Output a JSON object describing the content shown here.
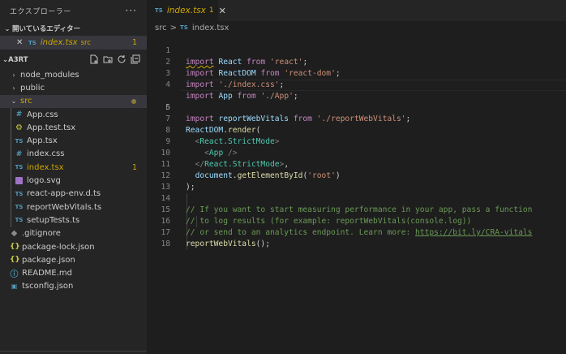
{
  "explorer": {
    "title": "エクスプローラー",
    "more": "···",
    "open_editors": {
      "header": "開いているエディター",
      "items": [
        {
          "close": "✕",
          "badge": "TS",
          "name": "index.tsx",
          "path": "src",
          "count": "1"
        }
      ]
    },
    "project": {
      "header": "A3RT",
      "tree": [
        {
          "name": "node_modules",
          "type": "folder",
          "expanded": false
        },
        {
          "name": "public",
          "type": "folder",
          "expanded": false
        },
        {
          "name": "src",
          "type": "folder",
          "expanded": true
        },
        {
          "name": "App.css",
          "type": "css"
        },
        {
          "name": "App.test.tsx",
          "type": "test"
        },
        {
          "name": "App.tsx",
          "type": "tsx"
        },
        {
          "name": "index.css",
          "type": "css"
        },
        {
          "name": "index.tsx",
          "type": "tsx",
          "count": "1"
        },
        {
          "name": "logo.svg",
          "type": "svg"
        },
        {
          "name": "react-app-env.d.ts",
          "type": "ts"
        },
        {
          "name": "reportWebVitals.ts",
          "type": "ts"
        },
        {
          "name": "setupTests.ts",
          "type": "ts"
        },
        {
          "name": ".gitignore",
          "type": "git"
        },
        {
          "name": "package-lock.json",
          "type": "json"
        },
        {
          "name": "package.json",
          "type": "json"
        },
        {
          "name": "README.md",
          "type": "info"
        },
        {
          "name": "tsconfig.json",
          "type": "tsconfig"
        }
      ]
    }
  },
  "editor": {
    "tab": {
      "badge": "TS",
      "name": "index.tsx",
      "count": "1",
      "close": "✕"
    },
    "breadcrumb": {
      "folder": "src",
      "sep": ">",
      "badge": "TS",
      "file": "index.tsx"
    },
    "line_numbers": [
      "1",
      "2",
      "3",
      "4",
      "5",
      "6",
      "7",
      "8",
      "9",
      "10",
      "11",
      "12",
      "13",
      "14",
      "15",
      "16",
      "17",
      "18"
    ],
    "code": {
      "l1": {
        "kw": "import",
        "id": "React",
        "from": "from",
        "str": "'react'",
        "end": ";"
      },
      "l2": {
        "kw": "import",
        "id": "ReactDOM",
        "from": "from",
        "str": "'react-dom'",
        "end": ";"
      },
      "l3": {
        "kw": "import",
        "str": "'./index.css'",
        "end": ";"
      },
      "l4": {
        "kw": "import",
        "id": "App",
        "from": "from",
        "str": "'./App'",
        "end": ";"
      },
      "l5": {
        "kw": "import",
        "id": "reportWebVitals",
        "from": "from",
        "str": "'./reportWebVitals'",
        "end": ";"
      },
      "l7": {
        "obj": "ReactDOM",
        "dot": ".",
        "fn": "render",
        "open": "("
      },
      "l8": {
        "open": "<",
        "tag": "React.StrictMode",
        "close": ">"
      },
      "l9": {
        "open": "<",
        "tag": "App",
        "close": " />"
      },
      "l10": {
        "open": "</",
        "tag": "React.StrictMode",
        "close": ">",
        "end": ","
      },
      "l11": {
        "obj": "document",
        "dot": ".",
        "fn": "getElementById",
        "open": "(",
        "str": "'root'",
        "close": ")"
      },
      "l12": {
        "text": ");"
      },
      "l14": {
        "text": "// If you want to start measuring performance in your app, pass a function"
      },
      "l15": {
        "text": "// to log results (for example: reportWebVitals(console.log))"
      },
      "l16": {
        "text": "// or send to an analytics endpoint. Learn more: ",
        "link": "https://bit.ly/CRA-vitals"
      },
      "l17": {
        "fn": "reportWebVitals",
        "end": "();"
      }
    }
  },
  "colors": {
    "sidebar_bg": "#252526",
    "editor_bg": "#1e1e1e",
    "warning": "#cca700",
    "ts_blue": "#519aba"
  }
}
